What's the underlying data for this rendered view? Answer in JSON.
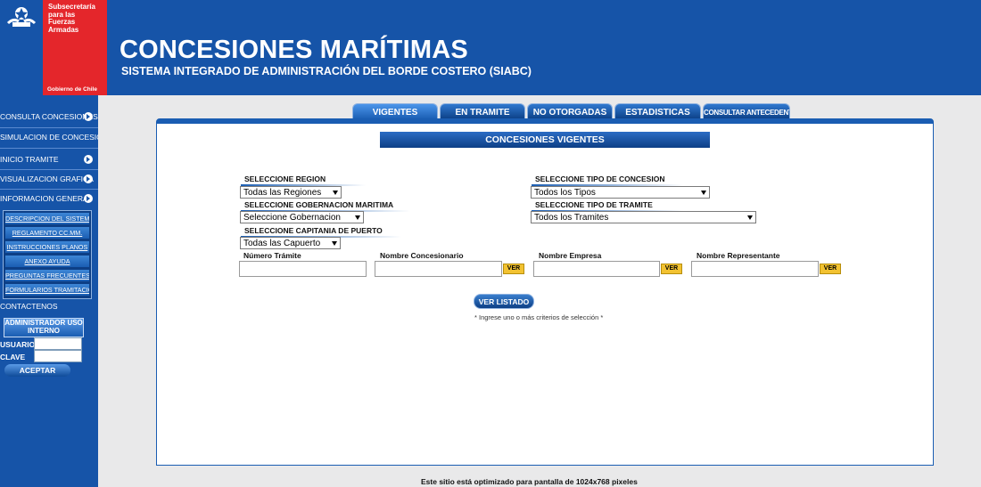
{
  "header": {
    "agency": "Subsecretaría para las Fuerzas Armadas",
    "gov": "Gobierno de Chile",
    "title": "CONCESIONES MARÍTIMAS",
    "subtitle": "SISTEMA INTEGRADO DE ADMINISTRACIÓN DEL BORDE COSTERO (SIABC)"
  },
  "sidebar": {
    "items": [
      {
        "label": "CONSULTA CONCESIONES"
      },
      {
        "label": "SIMULACION DE CONCESION"
      },
      {
        "label": "INICIO TRAMITE"
      },
      {
        "label": "VISUALIZACION GRAFICA"
      },
      {
        "label": "INFORMACION GENERAL"
      }
    ],
    "subitems": [
      "DESCRIPCION DEL SISTEMA",
      "REGLAMENTO CC.MM.",
      "INSTRUCCIONES PLANOS",
      "ANEXO AYUDA",
      "PREGUNTAS FRECUENTES",
      "FORMULARIOS TRAMITACION"
    ],
    "contact": "CONTACTENOS",
    "admin_title": "ADMINISTRADOR USO INTERNO",
    "user_label": "USUARIO",
    "key_label": "CLAVE",
    "accept": "ACEPTAR"
  },
  "tabs": [
    "VIGENTES",
    "EN TRAMITE",
    "NO OTORGADAS",
    "ESTADISTICAS",
    "CONSULTAR ANTECEDENTES"
  ],
  "main": {
    "panel_title": "CONCESIONES VIGENTES",
    "region_label": "SELECCIONE REGION",
    "region_value": "Todas las Regiones",
    "gob_label": "SELECCIONE GOBERNACION MARITIMA",
    "gob_value": "Seleccione Gobernacion",
    "cap_label": "SELECCIONE CAPITANIA DE PUERTO",
    "cap_value": "Todas las Capuerto",
    "tipo_conc_label": "SELECCIONE TIPO DE CONCESION",
    "tipo_conc_value": "Todos los Tipos",
    "tipo_tram_label": "SELECCIONE TIPO DE TRAMITE",
    "tipo_tram_value": "Todos los Tramites",
    "num_tramite": "Número Trámite",
    "nom_concesionario": "Nombre Concesionario",
    "nom_empresa": "Nombre Empresa",
    "nom_representante": "Nombre Representante",
    "ver": "VER",
    "ver_listado": "VER LISTADO",
    "hint": "* Ingrese uno o más criterios de selección *"
  },
  "footer": "Este sitio está optimizado para pantalla de 1024x768 pixeles"
}
